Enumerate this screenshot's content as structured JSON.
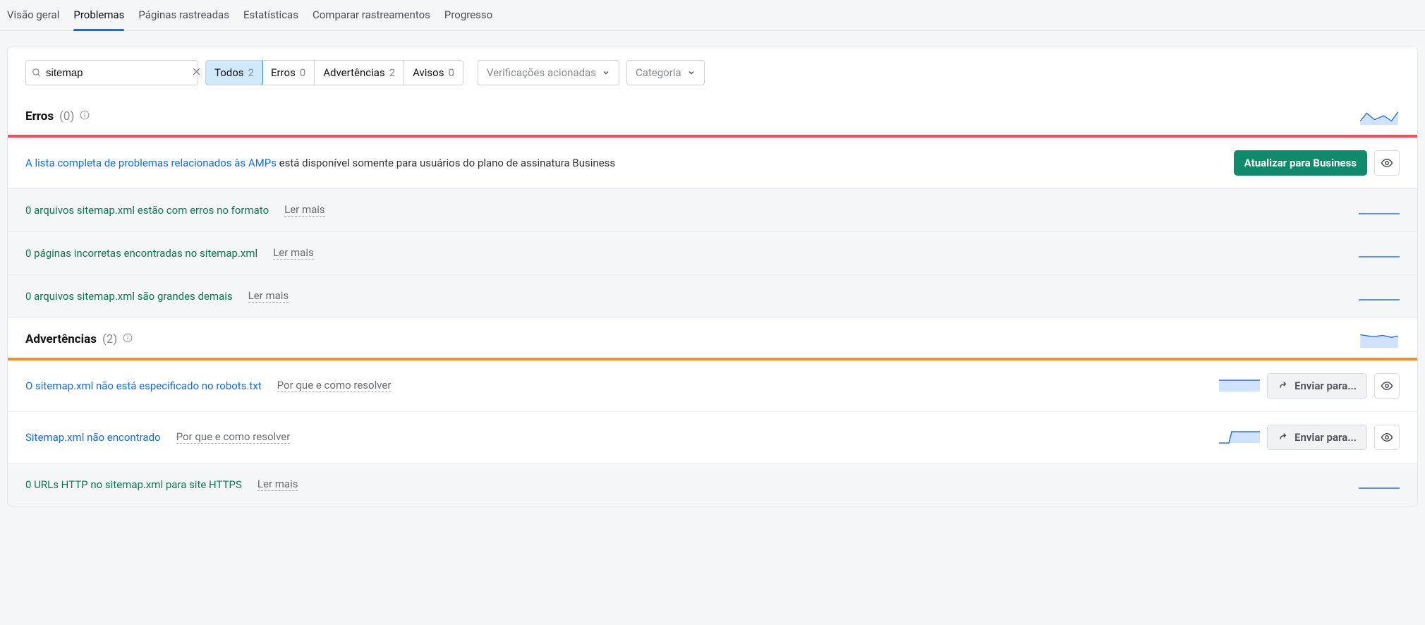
{
  "tabs": {
    "overview": "Visão geral",
    "problems": "Problemas",
    "crawled": "Páginas rastreadas",
    "stats": "Estatísticas",
    "compare": "Comparar rastreamentos",
    "progress": "Progresso"
  },
  "search": {
    "value": "sitemap",
    "placeholder": ""
  },
  "filters": {
    "all": {
      "label": "Todos",
      "count": "2"
    },
    "errors": {
      "label": "Erros",
      "count": "0"
    },
    "warnings": {
      "label": "Advertências",
      "count": "2"
    },
    "notices": {
      "label": "Avisos",
      "count": "0"
    }
  },
  "selects": {
    "triggered": "Verificações acionadas",
    "category": "Categoria"
  },
  "sections": {
    "errors": {
      "title": "Erros",
      "count": "(0)"
    },
    "warnings": {
      "title": "Advertências",
      "count": "(2)"
    }
  },
  "rows": {
    "amp_link": "A lista completa de problemas relacionados às AMPs",
    "amp_rest": " está disponível somente para usuários do plano de assinatura Business",
    "e1": "0 arquivos sitemap.xml estão com erros no formato",
    "e2": "0 páginas incorretas encontradas no sitemap.xml",
    "e3": "0 arquivos sitemap.xml são grandes demais",
    "w1": "O sitemap.xml não está especificado no robots.txt",
    "w2": "Sitemap.xml não encontrado",
    "w3": "0 URLs HTTP no sitemap.xml para site HTTPS",
    "read_more": "Ler mais",
    "why_how": "Por que e como resolver"
  },
  "buttons": {
    "upgrade": "Atualizar para Business",
    "send": "Enviar para..."
  }
}
